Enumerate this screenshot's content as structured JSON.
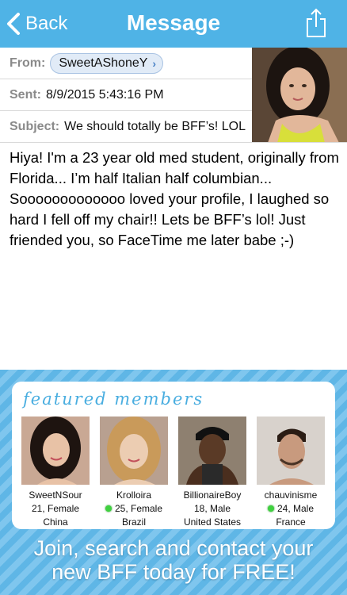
{
  "nav": {
    "back_label": "Back",
    "title": "Message"
  },
  "header": {
    "from_label": "From:",
    "from_value": "SweetAShoneY",
    "sent_label": "Sent:",
    "sent_value": "8/9/2015 5:43:16 PM",
    "subject_label": "Subject:",
    "subject_value": "We should totally be BFF’s! LOL"
  },
  "message": {
    "body": "Hiya! I'm a 23 year old med student, originally from Florida... I’m half Italian half columbian... Sooooooooooooo loved your profile, I laughed so hard I fell off my chair!! Lets be BFF’s lol! Just friended you, so FaceTime me later babe ;-)"
  },
  "featured": {
    "title": "featured members",
    "members": [
      {
        "name": "SweetNSour",
        "age_gender": "21, Female",
        "location": "China",
        "online": false
      },
      {
        "name": "Krolloira",
        "age_gender": "25, Female",
        "location": "Brazil",
        "online": true
      },
      {
        "name": "BillionaireBoy",
        "age_gender": "18, Male",
        "location": "United States",
        "online": false
      },
      {
        "name": "chauvinisme",
        "age_gender": "24, Male",
        "location": "France",
        "online": true
      }
    ]
  },
  "cta": {
    "line1": "Join, search and contact your",
    "line2": "new BFF today for FREE!"
  },
  "colors": {
    "nav_bar": "#4fb3e6",
    "accent": "#4aaee0",
    "online": "#3fd13f"
  }
}
